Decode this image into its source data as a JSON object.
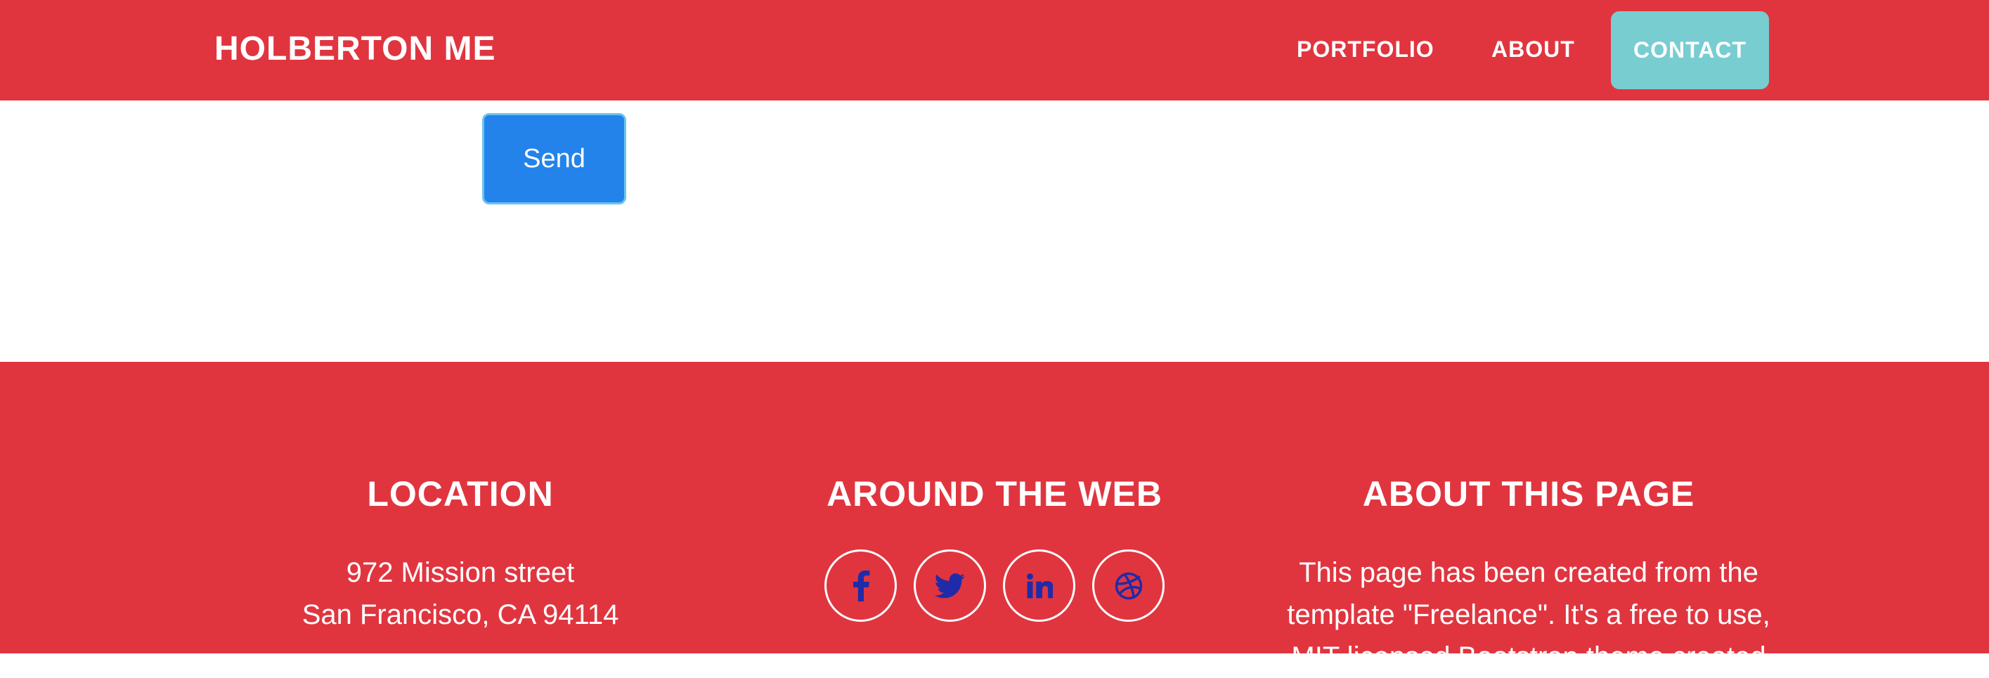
{
  "navbar": {
    "brand": "HOLBERTON ME",
    "links": [
      "PORTFOLIO",
      "ABOUT",
      "CONTACT"
    ],
    "background_color": "#e0353f",
    "active_link_color": "#78cdd1"
  },
  "form": {
    "send_label": "Send",
    "button_color": "#2383ea"
  },
  "footer": {
    "location": {
      "title": "LOCATION",
      "lines": [
        "972 Mission street",
        "San Francisco, CA 94114"
      ]
    },
    "around_the_web": {
      "title": "AROUND THE WEB",
      "icons": [
        "facebook-icon",
        "twitter-icon",
        "linkedin-icon",
        "dribbble-icon"
      ]
    },
    "about_this_page": {
      "title": "ABOUT THIS PAGE",
      "lines": [
        "This page has been created from the",
        "template \"Freelance\". It's a free to use,",
        "MIT licensed Bootstrap theme created"
      ]
    },
    "background_color": "#e0353f"
  }
}
